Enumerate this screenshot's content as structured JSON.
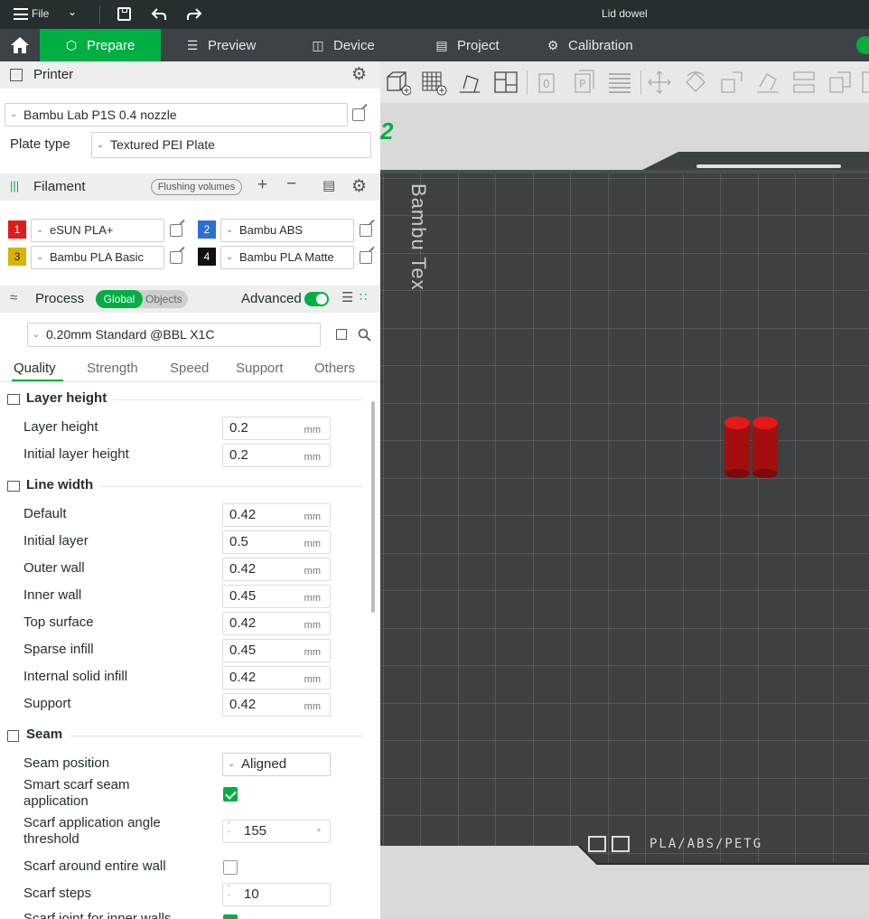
{
  "titlebar": {
    "file": "File",
    "title": "Lid dowel"
  },
  "tabs": [
    {
      "label": "Prepare",
      "icon": "cube-icon"
    },
    {
      "label": "Preview",
      "icon": "layers-icon"
    },
    {
      "label": "Device",
      "icon": "device-icon"
    },
    {
      "label": "Project",
      "icon": "project-icon"
    },
    {
      "label": "Calibration",
      "icon": "calibration-icon"
    }
  ],
  "printer": {
    "section_label": "Printer",
    "printer_name": "Bambu Lab P1S 0.4 nozzle",
    "plate_type_label": "Plate type",
    "plate_type": "Textured PEI Plate"
  },
  "filament": {
    "section_label": "Filament",
    "flushing_label": "Flushing volumes",
    "items": [
      {
        "num": "1",
        "name": "eSUN PLA+",
        "color": "#e01b1b"
      },
      {
        "num": "2",
        "name": "Bambu ABS",
        "color": "#2b6fd6"
      },
      {
        "num": "3",
        "name": "Bambu PLA Basic",
        "color": "#d9b300"
      },
      {
        "num": "4",
        "name": "Bambu PLA Matte",
        "color": "#111111"
      }
    ]
  },
  "process": {
    "section_label": "Process",
    "global_label": "Global",
    "objects_label": "Objects",
    "advanced_label": "Advanced",
    "advanced_on": true,
    "profile": "0.20mm Standard @BBL X1C"
  },
  "quality_tabs": [
    "Quality",
    "Strength",
    "Speed",
    "Support",
    "Others"
  ],
  "groups": {
    "layer_height": {
      "title": "Layer height",
      "rows": [
        {
          "label": "Layer height",
          "value": "0.2",
          "unit": "mm"
        },
        {
          "label": "Initial layer height",
          "value": "0.2",
          "unit": "mm"
        }
      ]
    },
    "line_width": {
      "title": "Line width",
      "rows": [
        {
          "label": "Default",
          "value": "0.42",
          "unit": "mm"
        },
        {
          "label": "Initial layer",
          "value": "0.5",
          "unit": "mm"
        },
        {
          "label": "Outer wall",
          "value": "0.42",
          "unit": "mm"
        },
        {
          "label": "Inner wall",
          "value": "0.45",
          "unit": "mm"
        },
        {
          "label": "Top surface",
          "value": "0.42",
          "unit": "mm"
        },
        {
          "label": "Sparse infill",
          "value": "0.45",
          "unit": "mm"
        },
        {
          "label": "Internal solid infill",
          "value": "0.42",
          "unit": "mm"
        },
        {
          "label": "Support",
          "value": "0.42",
          "unit": "mm"
        }
      ]
    },
    "seam": {
      "title": "Seam",
      "seam_position_label": "Seam position",
      "seam_position": "Aligned",
      "smart_scarf_label_1": "Smart scarf seam",
      "smart_scarf_label_2": "application",
      "smart_scarf_checked": true,
      "scarf_angle_label_1": "Scarf application angle",
      "scarf_angle_label_2": "threshold",
      "scarf_angle_value": "155",
      "scarf_angle_unit": "°",
      "scarf_entire_wall_label": "Scarf around entire wall",
      "scarf_entire_wall_checked": false,
      "scarf_steps_label": "Scarf steps",
      "scarf_steps_value": "10",
      "scarf_inner_label": "Scarf joint for inner walls",
      "scarf_inner_checked": true
    }
  },
  "plate": {
    "material_label": "PLA/ABS/PETG",
    "brand_side_label": "Bambu Tex",
    "plate_number": "2"
  }
}
